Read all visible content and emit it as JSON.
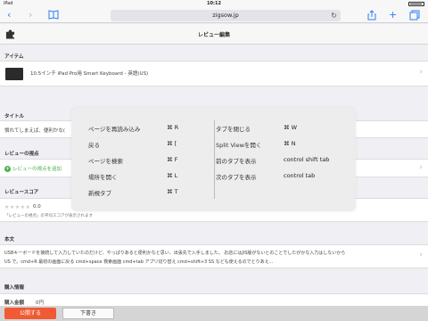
{
  "status": {
    "device": "iPad",
    "time": "10:12"
  },
  "browser": {
    "url": "zigsow.jp"
  },
  "page": {
    "title": "レビュー編集",
    "sections": {
      "item_label": "アイテム",
      "item_name": "10.5インチ iPad Pro用 Smart Keyboard - 英語(US)",
      "title_label": "タイトル",
      "title_value": "慣れてしまえば、便利かな(",
      "viewpoint_label": "レビューの視点",
      "viewpoint_add": "レビューの視点を追加",
      "score_label": "レビュースコア",
      "score_value": "0.0",
      "score_note": "「レビューの視点」の平均スコアが表示されます",
      "body_label": "本文",
      "body_line1": "USBキーボードを接続して入力していたのだけど、やっぱりあると便利かなと思い、出張先で入手しました。 お店にはJIS版がないとのことでしたがかな入力はしないから",
      "body_line2": "US で。cmd+R 最初の画面に戻る cmd+space 検索画面 cmd+tab アプリ切り替え cmd+shift+3 SS なども使えるのでとりあえ...",
      "purchase_label": "購入情報",
      "purchase_amount_label": "購入金額",
      "purchase_amount_value": "0円"
    }
  },
  "shortcuts": {
    "left": [
      {
        "label": "ページを再読み込み",
        "key": "⌘ R"
      },
      {
        "label": "戻る",
        "key": "⌘ ["
      },
      {
        "label": "ページを検索",
        "key": "⌘ F"
      },
      {
        "label": "場所を開く",
        "key": "⌘ L"
      },
      {
        "label": "新規タブ",
        "key": "⌘ T"
      }
    ],
    "right": [
      {
        "label": "タブを閉じる",
        "key": "⌘ W"
      },
      {
        "label": "Split Viewを開く",
        "key": "⌘ N"
      },
      {
        "label": "前のタブを表示",
        "key": "control shift tab"
      },
      {
        "label": "次のタブを表示",
        "key": "control tab"
      }
    ]
  },
  "footer": {
    "publish": "公開する",
    "draft": "下書き"
  },
  "colors": {
    "accent": "#2d7cf6",
    "publish": "#f05a35",
    "green": "#4caf50"
  },
  "icons": [
    "back-icon",
    "forward-icon",
    "bookmarks-icon",
    "reload-icon",
    "share-icon",
    "add-tab-icon",
    "tabs-icon",
    "puzzle-icon",
    "keyboard-thumbnail",
    "add-icon",
    "chevron-right-icon",
    "star-icon"
  ]
}
